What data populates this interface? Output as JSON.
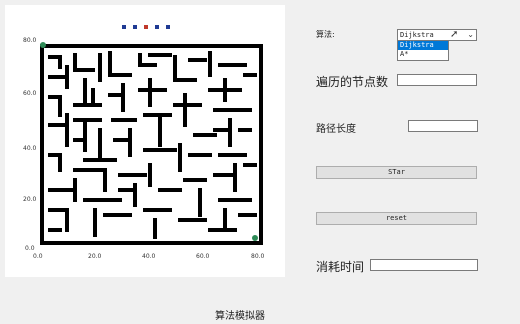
{
  "plot": {
    "x_ticks": [
      "0.0",
      "20.0",
      "40.0",
      "60.0",
      "80.0"
    ],
    "y_ticks": [
      "80.0",
      "60.0",
      "40.0",
      "20.0",
      "0.0"
    ],
    "legend_colors": [
      "#1f3a93",
      "#1f3a93",
      "#c0392b",
      "#1f3a93",
      "#1f3a93"
    ],
    "start_color": "#2e8b57",
    "end_color": "#2e8b57"
  },
  "controls": {
    "algorithm_label": "算法:",
    "algorithm_selected": "Dijkstra",
    "algorithm_options": [
      "Dijkstra",
      "A*"
    ],
    "nodes_label": "遍历的节点数",
    "nodes_value": "",
    "path_label": "路径长度",
    "path_value": "",
    "start_button": "STar",
    "reset_button": "reset",
    "time_label": "消耗时间",
    "time_value": ""
  },
  "footer": {
    "title": "算法模拟器"
  }
}
